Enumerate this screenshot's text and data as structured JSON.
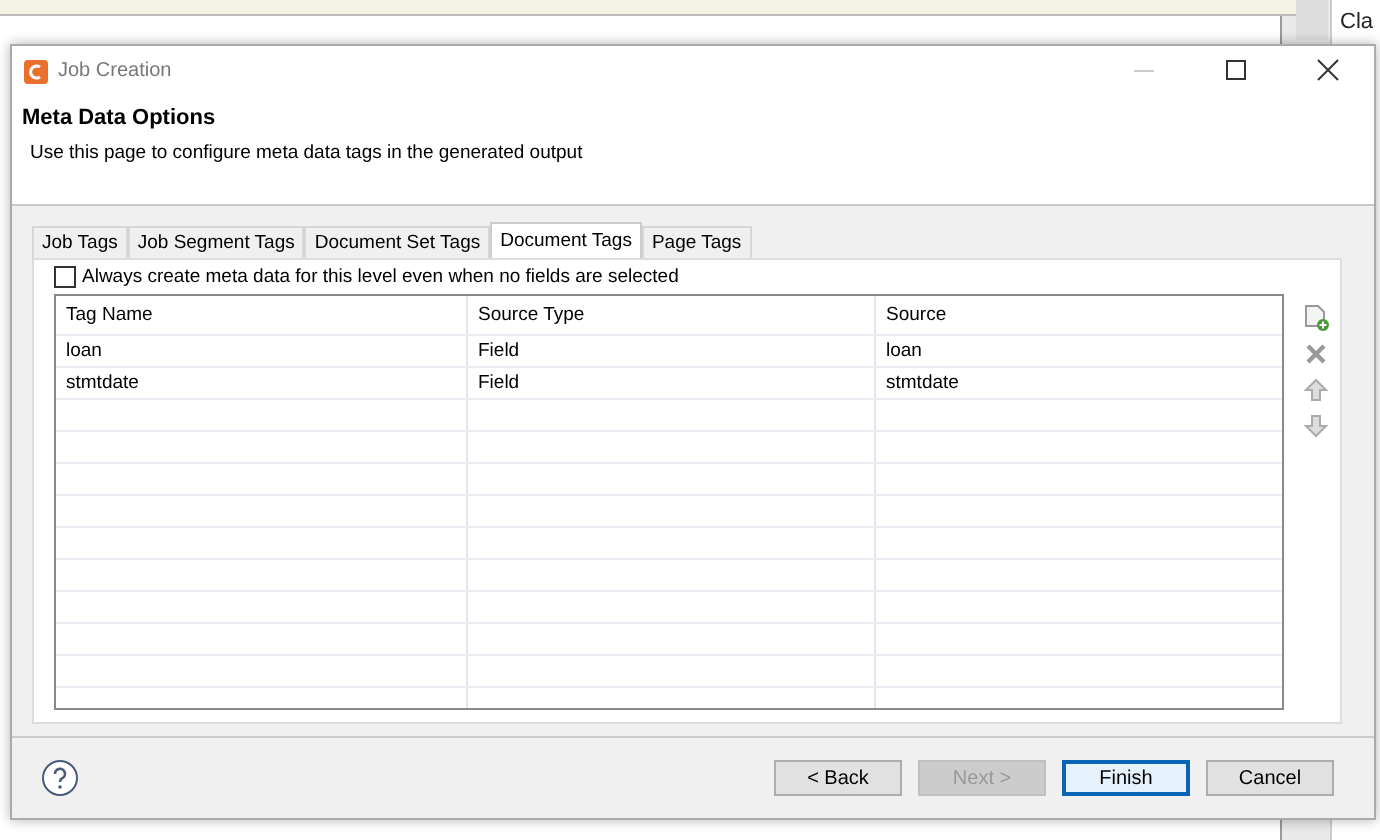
{
  "background": {
    "text": "Cla"
  },
  "window": {
    "title": "Job Creation"
  },
  "header": {
    "title": "Meta Data Options",
    "description": "Use this page to configure meta data tags in the generated output"
  },
  "tabs": [
    {
      "label": "Job Tags",
      "selected": false
    },
    {
      "label": "Job Segment Tags",
      "selected": false
    },
    {
      "label": "Document Set Tags",
      "selected": false
    },
    {
      "label": "Document Tags",
      "selected": true
    },
    {
      "label": "Page Tags",
      "selected": false
    }
  ],
  "option": {
    "label": "Always create meta data for this level even when no fields are selected",
    "checked": false
  },
  "table": {
    "columns": [
      "Tag Name",
      "Source Type",
      "Source"
    ],
    "rows": [
      [
        "loan",
        "Field",
        "loan"
      ],
      [
        "stmtdate",
        "Field",
        "stmtdate"
      ]
    ]
  },
  "buttons": [
    {
      "label": "< Back",
      "disabled": false,
      "default": false
    },
    {
      "label": "Next >",
      "disabled": true,
      "default": false
    },
    {
      "label": "Finish",
      "disabled": false,
      "default": true
    },
    {
      "label": "Cancel",
      "disabled": false,
      "default": false
    }
  ]
}
